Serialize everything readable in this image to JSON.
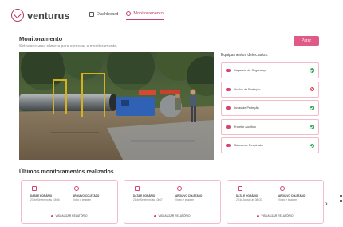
{
  "brand": {
    "name": "venturus",
    "accent": "#b4325a"
  },
  "nav": {
    "items": [
      {
        "label": "Dashboard",
        "active": false
      },
      {
        "label": "Monitoramento",
        "active": true
      }
    ]
  },
  "header": {
    "title": "Monitoramento",
    "subtitle": "Selecione uma câmera para começar o monitoramento.",
    "action_label": "Parar"
  },
  "equipment": {
    "title": "Equipamentos detectados:",
    "items": [
      {
        "label": "Capacete de Segurança",
        "status": "ok"
      },
      {
        "label": "Óculos de Proteção",
        "status": "missing"
      },
      {
        "label": "Luvas de Proteção",
        "status": "ok"
      },
      {
        "label": "Protetor Auditivo",
        "status": "ok"
      },
      {
        "label": "Máscara e Respirador",
        "status": "ok"
      }
    ]
  },
  "recent": {
    "title": "Últimos monitoramentos realizados",
    "date_label": "DATA E HORÁRIO",
    "file_label": "ARQUIVO COLETADO",
    "link_label": "VISUALIZAR RELATÓRIO",
    "cards": [
      {
        "date": "20 de Setembro às 10h56",
        "file": "Vídeo e imagem"
      },
      {
        "date": "21 de Setembro às 10h07",
        "file": "Vídeo e imagem"
      },
      {
        "date": "27 de Agosto às 08h33",
        "file": "Vídeo e imagem"
      }
    ]
  },
  "colors": {
    "accent": "#e05a87",
    "ok": "#3ca55c",
    "missing": "#d9434b",
    "border": "#f2bcc9"
  }
}
